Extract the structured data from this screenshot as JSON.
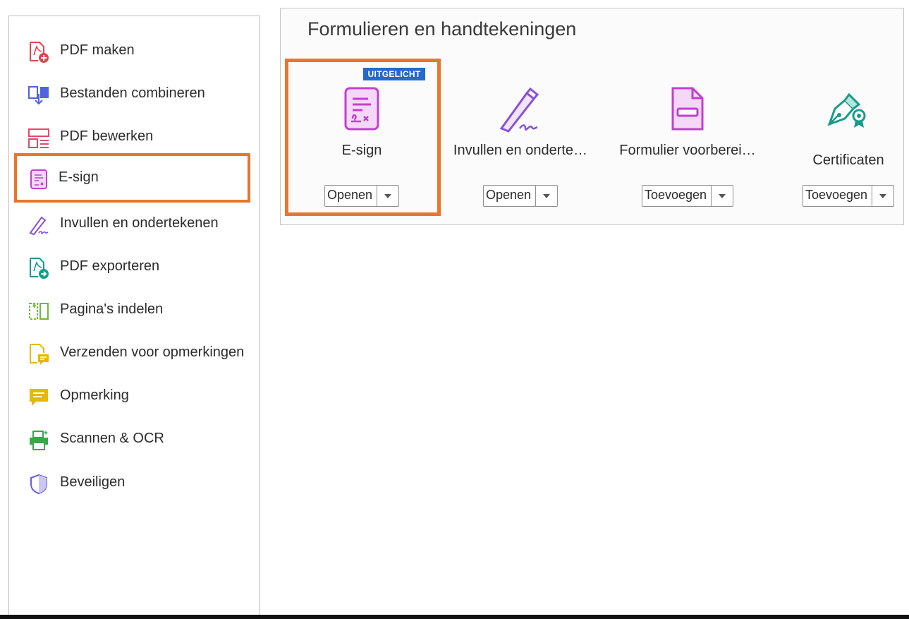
{
  "sidebar": {
    "items": [
      {
        "label": "PDF maken",
        "icon": "create-pdf-icon",
        "color": "#e2444d"
      },
      {
        "label": "Bestanden combineren",
        "icon": "combine-files-icon",
        "color": "#4f63e0"
      },
      {
        "label": "PDF bewerken",
        "icon": "edit-pdf-icon",
        "color": "#e24a6a"
      },
      {
        "label": "E-sign",
        "icon": "esign-icon",
        "color": "#c23fd0"
      },
      {
        "label": "Invullen en ondertekenen",
        "icon": "fill-sign-icon",
        "color": "#8a4fd6"
      },
      {
        "label": "PDF exporteren",
        "icon": "export-pdf-icon",
        "color": "#1a9a8c"
      },
      {
        "label": "Pagina's indelen",
        "icon": "organize-pages-icon",
        "color": "#6cbb3c"
      },
      {
        "label": "Verzenden voor opmerkingen",
        "icon": "send-comments-icon",
        "color": "#e6b800"
      },
      {
        "label": "Opmerking",
        "icon": "comment-icon",
        "color": "#e6b800"
      },
      {
        "label": "Scannen & OCR",
        "icon": "scan-ocr-icon",
        "color": "#3aa84a"
      },
      {
        "label": "Beveiligen",
        "icon": "protect-shield-icon",
        "color": "#6b5fd6"
      }
    ]
  },
  "panel": {
    "title": "Formulieren en handtekeningen",
    "tools": [
      {
        "name": "E-sign",
        "button": "Openen",
        "badge": "UITGELICHT",
        "icon": "esign-document-icon"
      },
      {
        "name": "Invullen en onderte…",
        "button": "Openen",
        "icon": "fill-sign-pen-icon"
      },
      {
        "name": "Formulier voorberei…",
        "button": "Toevoegen",
        "icon": "prepare-form-icon"
      },
      {
        "name": "Certificaten",
        "button": "Toevoegen",
        "icon": "certificate-pen-icon"
      }
    ]
  },
  "colors": {
    "highlight": "#e8762b",
    "badge": "#2669c8",
    "magenta": "#c23fd0"
  }
}
